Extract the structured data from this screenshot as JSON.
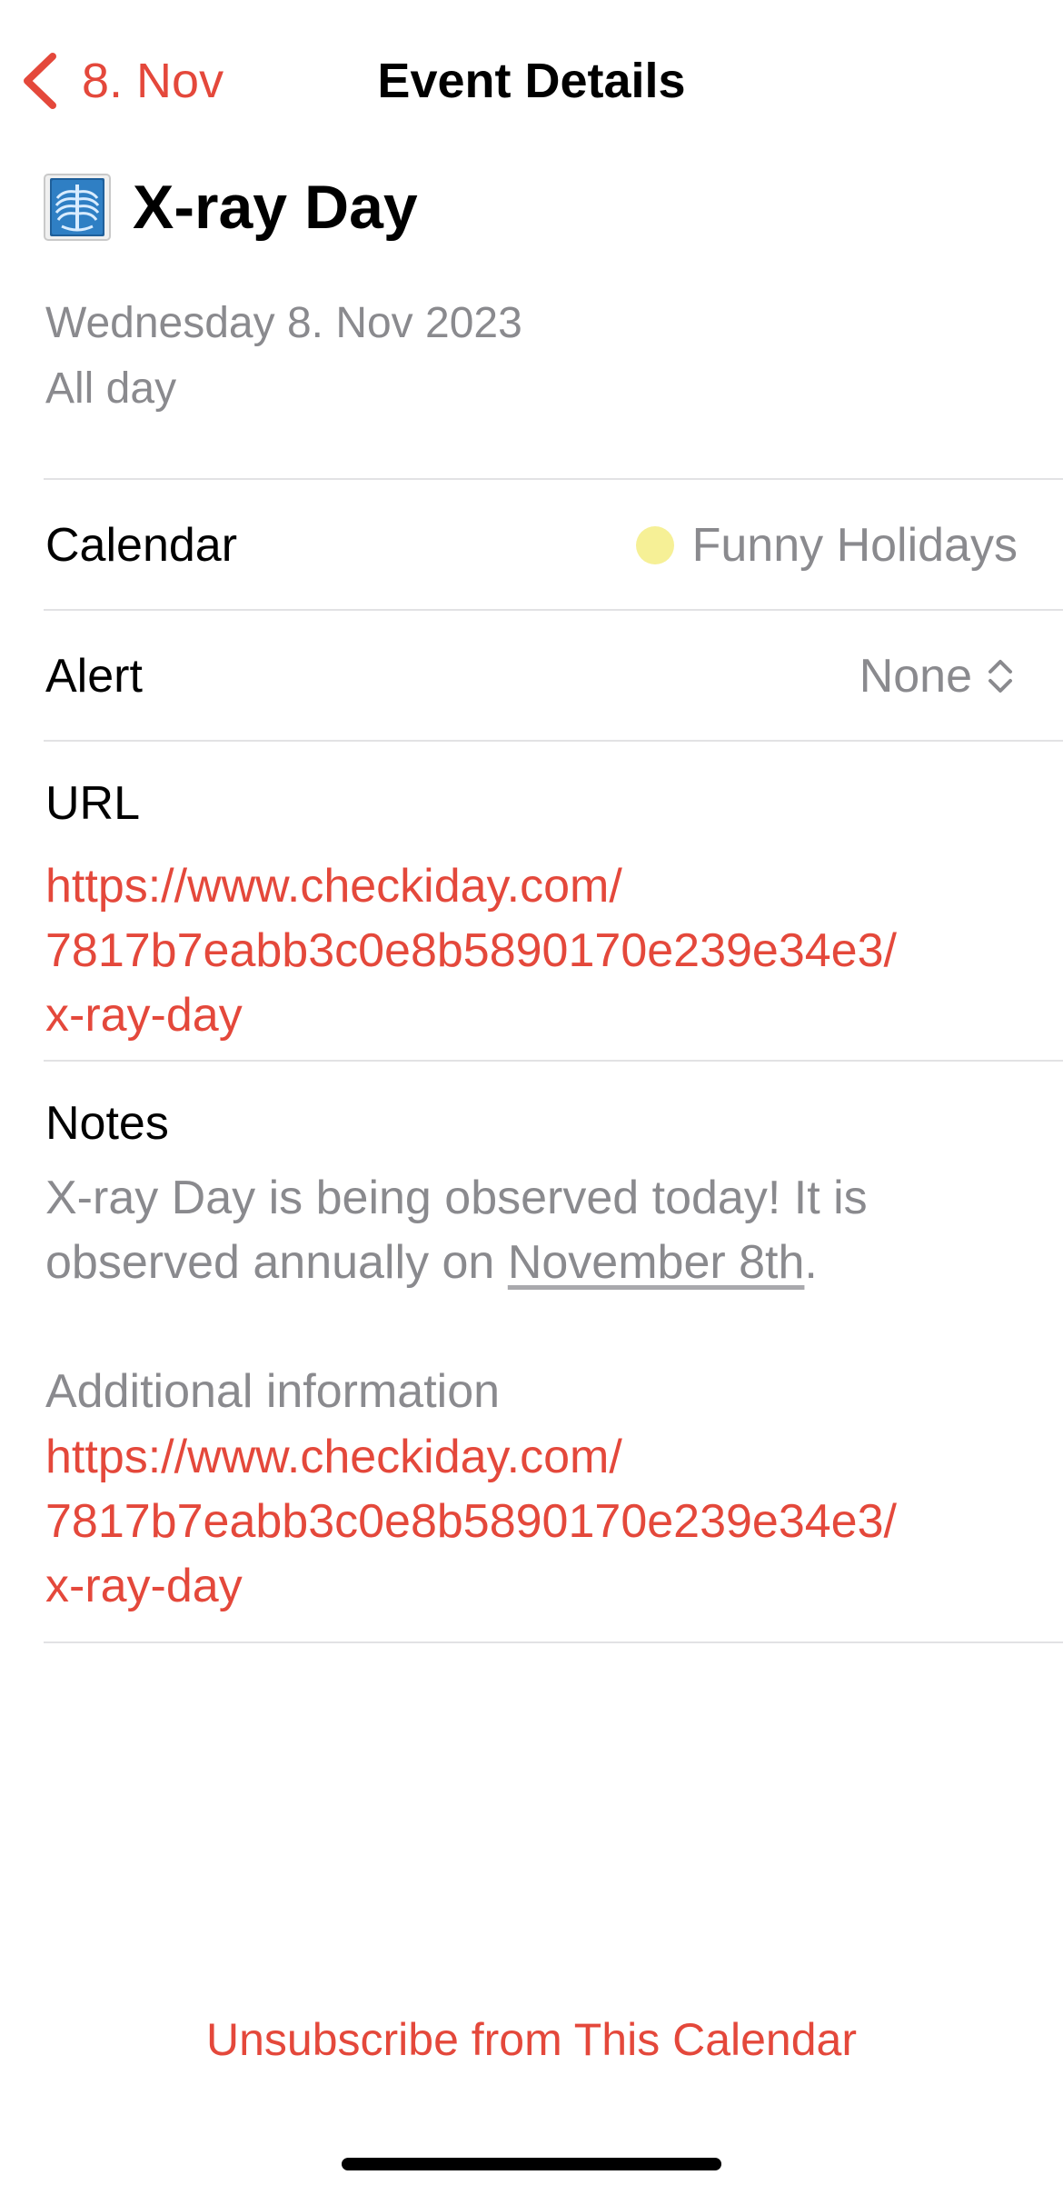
{
  "nav": {
    "back_label": "8. Nov",
    "title": "Event Details"
  },
  "event": {
    "icon": "x-ray-chest-icon",
    "title": "X-ray Day",
    "date": "Wednesday 8. Nov 2023",
    "time": "All day"
  },
  "calendar": {
    "label": "Calendar",
    "value": "Funny Holidays",
    "color": "#f6f096"
  },
  "alert": {
    "label": "Alert",
    "value": "None",
    "icon": "up-down-chevron-icon"
  },
  "url": {
    "label": "URL",
    "lines": [
      "https://www.checkiday.com/",
      "7817b7eabb3c0e8b5890170e239e34e3/",
      "x-ray-day"
    ]
  },
  "notes": {
    "label": "Notes",
    "text_part1": "X-ray Day is being observed today! It is observed annually on ",
    "date_link": "November 8th",
    "text_part2": ".",
    "additional_label": "Additional information",
    "link_lines": [
      "https://www.checkiday.com/",
      "7817b7eabb3c0e8b5890170e239e34e3/",
      "x-ray-day"
    ]
  },
  "footer": {
    "unsubscribe_label": "Unsubscribe from This Calendar"
  },
  "colors": {
    "accent": "#e4483b",
    "secondary_text": "#8a8a8e",
    "separator": "#e2e2e4"
  }
}
